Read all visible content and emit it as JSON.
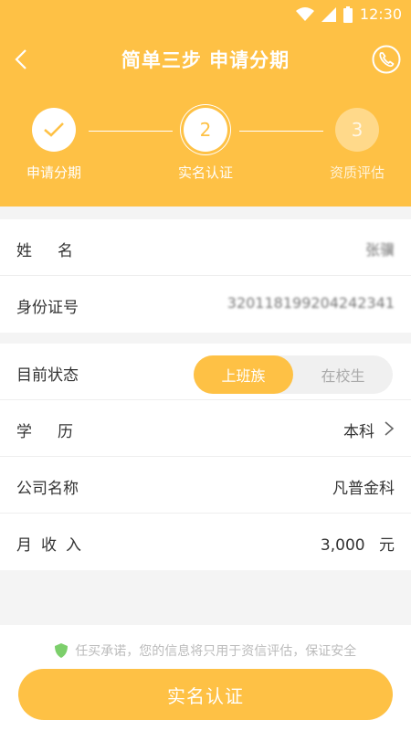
{
  "status_bar": {
    "time": "12:30"
  },
  "header": {
    "title": "简单三步 申请分期"
  },
  "steps": [
    {
      "label": "申请分期",
      "state": "done"
    },
    {
      "label": "实名认证",
      "state": "current",
      "number": "2"
    },
    {
      "label": "资质评估",
      "state": "next",
      "number": "3"
    }
  ],
  "identity": {
    "name_label": "姓名",
    "name_value": "张骥",
    "id_label": "身份证号",
    "id_value": "320118199204242341"
  },
  "info": {
    "status_label": "目前状态",
    "status_options": [
      "上班族",
      "在校生"
    ],
    "status_selected": "上班族",
    "education_label": "学历",
    "education_value": "本科",
    "company_label": "公司名称",
    "company_value": "凡普金科",
    "income_label": "月收入",
    "income_value": "3,000",
    "income_unit": "元"
  },
  "footer": {
    "note": "任买承诺，您的信息将只用于资信评估，保证安全",
    "submit_label": "实名认证"
  },
  "colors": {
    "accent": "#fec145",
    "background": "#f4f4f4",
    "shield": "#7ccf6b"
  }
}
